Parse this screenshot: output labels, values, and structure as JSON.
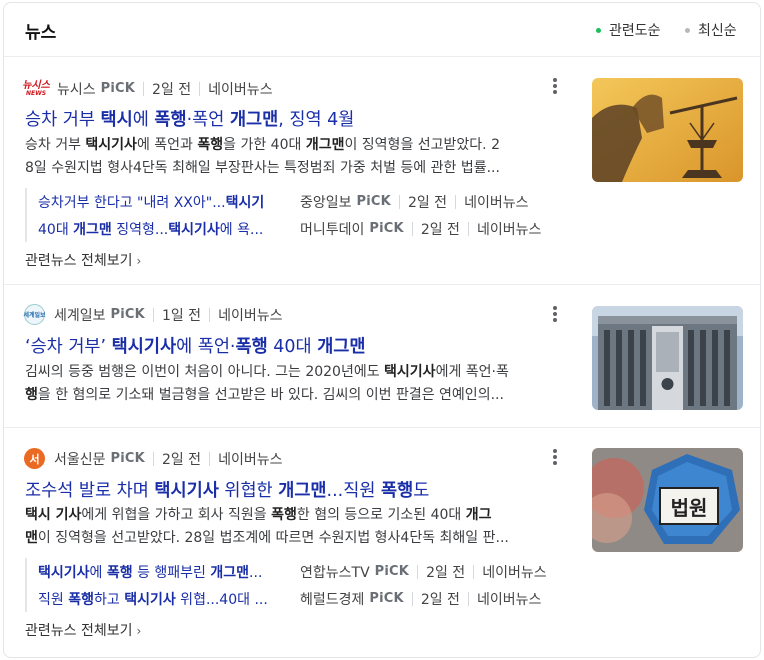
{
  "header": {
    "title": "뉴스",
    "sort_relevance": "관련도순",
    "sort_latest": "최신순",
    "active_color": "#19c05a",
    "inactive_color": "#b5b8bc"
  },
  "articles": [
    {
      "logo_text": "뉴시스",
      "logo_sub": "NEWS",
      "source": "뉴시스",
      "pick": "PiCK",
      "time": "2일 전",
      "portal": "네이버뉴스",
      "title_parts": [
        "승차 거부 ",
        "택시",
        "에 ",
        "폭행",
        "·폭언 ",
        "개그맨",
        ", 징역 4월"
      ],
      "desc_line1_parts": [
        "승차 거부 ",
        "택시기사",
        "에 폭언과 ",
        "폭행",
        "을 가한 40대 ",
        "개그맨",
        "이 징역형을 선고받았다. 2"
      ],
      "desc_line2": "8일 수원지법 형사4단독 최해일 부장판사는 특정범죄 가중 처벌 등에 관한 법률...",
      "related": [
        {
          "title_parts": [
            "승차거부 한다고 \"내려 XX아\"...",
            "택시기",
            ""
          ],
          "source": "중앙일보",
          "pick": "PiCK",
          "time": "2일 전",
          "portal": "네이버뉴스"
        },
        {
          "title_parts": [
            "40대 ",
            "개그맨",
            " 징역형...",
            "택시기사",
            "에 욕..."
          ],
          "source": "머니투데이",
          "pick": "PiCK",
          "time": "2일 전",
          "portal": "네이버뉴스"
        }
      ],
      "all_link": "관련뉴스 전체보기",
      "thumb_icon": "scales-of-justice-image"
    },
    {
      "logo_text": "세계일보",
      "source": "세계일보",
      "pick": "PiCK",
      "time": "1일 전",
      "portal": "네이버뉴스",
      "title_parts": [
        "‘승차 거부’ ",
        "택시기사",
        "에 폭언·",
        "폭행",
        " 40대 ",
        "개그맨",
        ""
      ],
      "desc_line1_parts": [
        "김씨의 등중 범행은 이번이 처음이 아니다. 그는 2020년에도 ",
        "택시기사",
        "에게 폭언·폭",
        "",
        "",
        "",
        ""
      ],
      "desc_line2_parts": [
        "행",
        "을 한 혐의로 기소돼 벌금형을 선고받은 바 있다. 김씨의 이번 판결은 연예인의..."
      ],
      "thumb_icon": "court-building-image"
    },
    {
      "logo_text": "서",
      "source": "서울신문",
      "pick": "PiCK",
      "time": "2일 전",
      "portal": "네이버뉴스",
      "title_parts": [
        "조수석 발로 차며 ",
        "택시기사",
        " 위협한 ",
        "개그맨",
        "...직원 ",
        "폭행",
        "도"
      ],
      "desc_line1_parts": [
        "택시 기사",
        "에게 위협을 가하고 회사 직원을 ",
        "폭행",
        "한 혐의 등으로 기소된 40대 ",
        "개그",
        "",
        ""
      ],
      "desc_line2_parts": [
        "맨",
        "이 징역형을 선고받았다. 28일 법조계에 따르면 수원지법 형사4단독 최해일 판..."
      ],
      "related": [
        {
          "title_parts": [
            "택시기사",
            "에 ",
            "폭행",
            " 등 행패부린 ",
            "개그맨",
            "..."
          ],
          "source": "연합뉴스TV",
          "pick": "PiCK",
          "time": "2일 전",
          "portal": "네이버뉴스"
        },
        {
          "title_parts": [
            "직원 ",
            "폭행",
            "하고 ",
            "택시기사",
            " 위협...40대 ..."
          ],
          "source": "헤럴드경제",
          "pick": "PiCK",
          "time": "2일 전",
          "portal": "네이버뉴스"
        }
      ],
      "all_link": "관련뉴스 전체보기",
      "thumb_icon": "court-sign-image",
      "thumb_sign": "법원"
    }
  ]
}
